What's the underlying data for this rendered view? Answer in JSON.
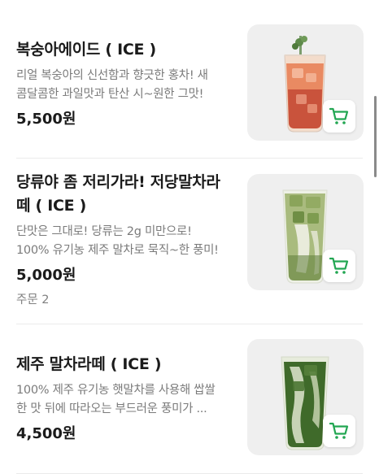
{
  "items": [
    {
      "name": "복숭아에이드 ( ICE )",
      "desc_lines": [
        "리얼 복숭아의 신선함과 향긋한 홍차! 새",
        "콤달콤한 과일맛과 탄산 시~원한 그맛!"
      ],
      "price": "5,500원",
      "orders": ""
    },
    {
      "name_lines": [
        "당류야 좀 저리가라! 저당말차라",
        "떼 ( ICE )"
      ],
      "desc_lines": [
        "단맛은 그대로! 당류는 2g 미만으로!",
        "100% 유기농 제주 말차로 묵직~한 풍미!"
      ],
      "price": "5,000원",
      "orders": "주문 2"
    },
    {
      "name": "제주 말차라떼 ( ICE )",
      "desc_lines": [
        "100% 제주 유기농 햇말차를 사용해 쌉쌀",
        "한 맛 뒤에 따라오는 부드러운 풍미가 ..."
      ],
      "price": "4,500원",
      "orders": ""
    }
  ],
  "colors": {
    "accent": "#22a652",
    "thumb_bg": "#efefef",
    "text": "#1b1b1b",
    "subtext": "#7b7b7b"
  },
  "icons": {
    "cart": "shopping-cart-icon"
  }
}
